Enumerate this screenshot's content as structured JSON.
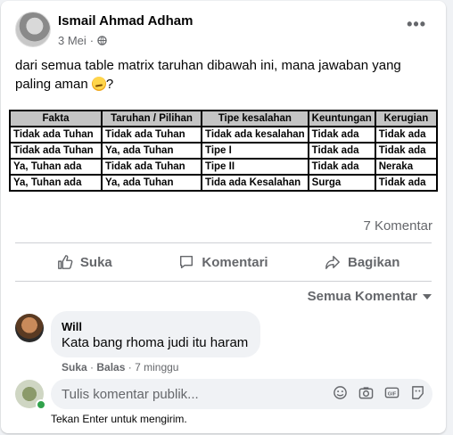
{
  "post": {
    "author": "Ismail Ahmad Adham",
    "date": "3 Mei",
    "separator": "·",
    "more_icon": "more-horizontal-icon",
    "text": "dari semua table matrix taruhan dibawah ini, mana jawaban yang paling aman",
    "text_suffix": "?",
    "emoji": "thinking-face-emoji"
  },
  "matrix": {
    "headers": [
      "Fakta",
      "Taruhan / Pilihan",
      "Tipe kesalahan",
      "Keuntungan",
      "Kerugian"
    ],
    "rows": [
      [
        "Tidak ada Tuhan",
        "Tidak ada Tuhan",
        "Tidak ada kesalahan",
        "Tidak ada",
        "Tidak ada"
      ],
      [
        "Tidak ada Tuhan",
        "Ya, ada Tuhan",
        "Tipe I",
        "Tidak ada",
        "Tidak ada"
      ],
      [
        "Ya, Tuhan ada",
        "Tidak ada Tuhan",
        "Tipe II",
        "Tidak ada",
        "Neraka"
      ],
      [
        "Ya, Tuhan ada",
        "Ya, ada Tuhan",
        "Tida ada Kesalahan",
        "Surga",
        "Tidak ada"
      ]
    ]
  },
  "stats": {
    "comments": "7 Komentar"
  },
  "actions": {
    "like": "Suka",
    "comment": "Komentari",
    "share": "Bagikan"
  },
  "sort": {
    "label": "Semua Komentar"
  },
  "comment": {
    "name": "Will",
    "text": "Kata bang rhoma judi itu haram",
    "like": "Suka",
    "reply": "Balas",
    "time": "7 minggu",
    "dot": "·"
  },
  "composer": {
    "placeholder": "Tulis komentar publik...",
    "hint": "Tekan Enter untuk mengirim.",
    "icons": [
      "emoji-icon",
      "camera-icon",
      "gif-icon",
      "sticker-icon"
    ]
  },
  "colors": {
    "muted": "#65676b",
    "online": "#31a24c",
    "background": "#f0f2f5"
  }
}
